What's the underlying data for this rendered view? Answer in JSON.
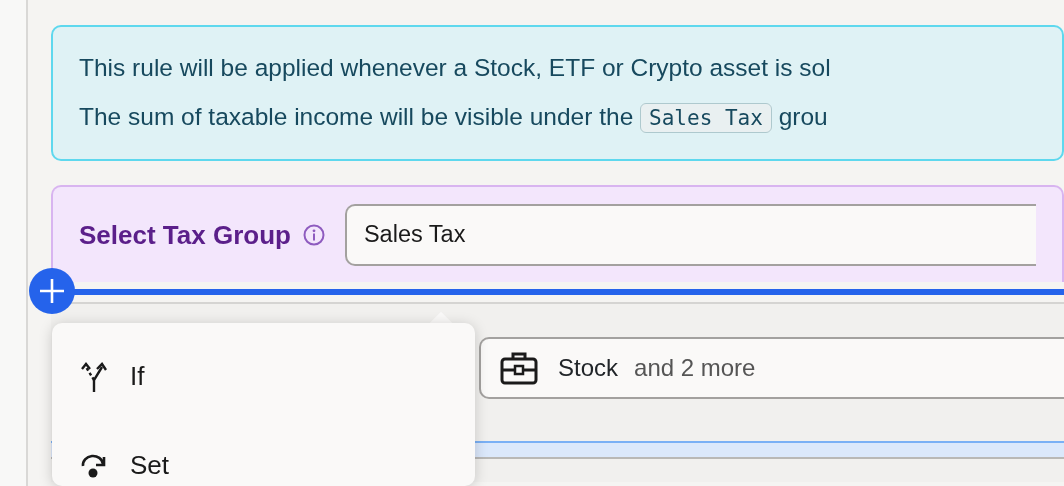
{
  "info": {
    "line_1": "This rule will be applied whenever a Stock, ETF or Crypto asset is sol",
    "line_2_start": "The sum of taxable income will be visible under the",
    "line_2_code": "Sales Tax",
    "line_2_end": "grou"
  },
  "tax_group": {
    "label": "Select Tax Group",
    "value": "Sales Tax"
  },
  "asset_filter": {
    "value": "Stock",
    "more": "and 2 more"
  },
  "menu": {
    "items": [
      {
        "label": "If",
        "kind": "branch"
      },
      {
        "label": "Set",
        "kind": "assign"
      }
    ]
  }
}
